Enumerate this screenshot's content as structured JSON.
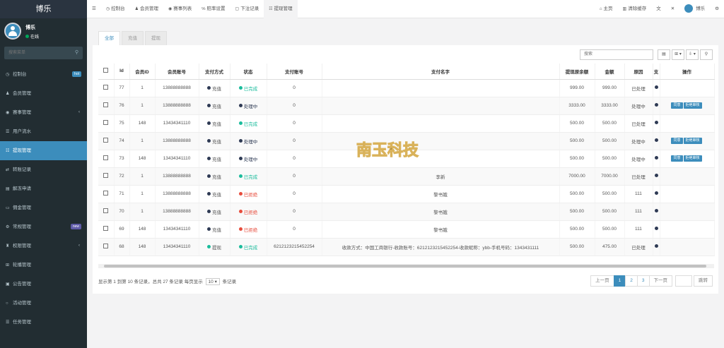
{
  "sidebar": {
    "brand": "博乐",
    "user_name": "博乐",
    "user_status": "在线",
    "search_placeholder": "搜索菜单",
    "items": [
      {
        "label": "控制台",
        "icon": "dashboard-icon",
        "glyph": "◷",
        "badge": "hot",
        "badge_color": "#3c8dbc"
      },
      {
        "label": "会员管理",
        "icon": "users-icon",
        "glyph": "♟"
      },
      {
        "label": "赛事管理",
        "icon": "event-icon",
        "glyph": "◉",
        "arrow": "‹"
      },
      {
        "label": "用户流水",
        "icon": "list-icon",
        "glyph": "☰"
      },
      {
        "label": "提现管理",
        "icon": "withdraw-icon",
        "glyph": "☷",
        "active": true
      },
      {
        "label": "转账记录",
        "icon": "transfer-icon",
        "glyph": "⇄"
      },
      {
        "label": "解冻申请",
        "icon": "unfreeze-icon",
        "glyph": "▤"
      },
      {
        "label": "佣金管理",
        "icon": "commission-icon",
        "glyph": "▭"
      },
      {
        "label": "常规管理",
        "icon": "settings-icon",
        "glyph": "⚙",
        "badge": "new",
        "badge_color": "#605ca8"
      },
      {
        "label": "权限管理",
        "icon": "permission-icon",
        "glyph": "♜",
        "arrow": "‹"
      },
      {
        "label": "轮播管理",
        "icon": "carousel-icon",
        "glyph": "⊞"
      },
      {
        "label": "公告管理",
        "icon": "notice-icon",
        "glyph": "▣"
      },
      {
        "label": "活动管理",
        "icon": "activity-icon",
        "glyph": "○"
      },
      {
        "label": "任务管理",
        "icon": "task-icon",
        "glyph": "☰"
      }
    ]
  },
  "topbar": {
    "menu_glyph": "☰",
    "tabs": [
      {
        "label": "控制台",
        "icon": "dashboard-icon",
        "glyph": "◷"
      },
      {
        "label": "会员管理",
        "icon": "users-icon",
        "glyph": "♟"
      },
      {
        "label": "赛事列表",
        "icon": "event-icon",
        "glyph": "◉"
      },
      {
        "label": "赔率设置",
        "icon": "odds-icon",
        "glyph": "℅"
      },
      {
        "label": "下注记录",
        "icon": "bet-icon",
        "glyph": "▢"
      },
      {
        "label": "提现管理",
        "icon": "withdraw-icon",
        "glyph": "☷",
        "active": true
      }
    ],
    "home_label": "主页",
    "clear_cache_label": "清除缓存",
    "translate_glyph": "文",
    "fullscreen_glyph": "✕",
    "user_label": "博乐",
    "settings_glyph": "⚙"
  },
  "panel": {
    "tabs": [
      "全部",
      "充值",
      "提现"
    ],
    "search_placeholder": "搜索",
    "toolbar_buttons": [
      "▤",
      "⊞ ▾",
      "⇩ ▾",
      "⚲"
    ],
    "columns": [
      "Id",
      "会员ID",
      "会员账号",
      "支付方式",
      "状态",
      "支付账号",
      "支付名字",
      "提现原余额",
      "金额",
      "原因",
      "支",
      "操作"
    ],
    "rows": [
      {
        "id": "77",
        "member_id": "1",
        "account": "13888888888",
        "pay_method": "充值",
        "pay_color": "#2e3a54",
        "status": "已完成",
        "status_color": "#1abc9c",
        "pay_account": "0",
        "pay_name": "",
        "orig_balance": "999.00",
        "amount": "999.00",
        "reason": "已处理",
        "actions": []
      },
      {
        "id": "76",
        "member_id": "1",
        "account": "13888888888",
        "pay_method": "充值",
        "pay_color": "#2e3a54",
        "status": "处理中",
        "status_color": "#2e3a54",
        "pay_account": "0",
        "pay_name": "",
        "orig_balance": "3333.00",
        "amount": "3333.00",
        "reason": "处理中",
        "actions": [
          "同意",
          "拒绝审核"
        ]
      },
      {
        "id": "75",
        "member_id": "148",
        "account": "13434341110",
        "pay_method": "充值",
        "pay_color": "#2e3a54",
        "status": "已完成",
        "status_color": "#1abc9c",
        "pay_account": "0",
        "pay_name": "",
        "orig_balance": "500.00",
        "amount": "500.00",
        "reason": "已处理",
        "actions": []
      },
      {
        "id": "74",
        "member_id": "1",
        "account": "13888888888",
        "pay_method": "充值",
        "pay_color": "#2e3a54",
        "status": "处理中",
        "status_color": "#2e3a54",
        "pay_account": "0",
        "pay_name": "",
        "orig_balance": "500.00",
        "amount": "500.00",
        "reason": "处理中",
        "actions": [
          "同意",
          "拒绝审核"
        ]
      },
      {
        "id": "73",
        "member_id": "148",
        "account": "13434341110",
        "pay_method": "充值",
        "pay_color": "#2e3a54",
        "status": "处理中",
        "status_color": "#2e3a54",
        "pay_account": "0",
        "pay_name": "",
        "orig_balance": "500.00",
        "amount": "500.00",
        "reason": "处理中",
        "actions": [
          "同意",
          "拒绝审核"
        ]
      },
      {
        "id": "72",
        "member_id": "1",
        "account": "13888888888",
        "pay_method": "充值",
        "pay_color": "#2e3a54",
        "status": "已完成",
        "status_color": "#1abc9c",
        "pay_account": "0",
        "pay_name": "李新",
        "orig_balance": "7000.00",
        "amount": "7000.00",
        "reason": "已处理",
        "actions": []
      },
      {
        "id": "71",
        "member_id": "1",
        "account": "13888888888",
        "pay_method": "充值",
        "pay_color": "#2e3a54",
        "status": "已拒绝",
        "status_color": "#e74c3c",
        "pay_account": "0",
        "pay_name": "黎书娥",
        "orig_balance": "500.00",
        "amount": "500.00",
        "reason": "111",
        "actions": []
      },
      {
        "id": "70",
        "member_id": "1",
        "account": "13888888888",
        "pay_method": "充值",
        "pay_color": "#2e3a54",
        "status": "已拒绝",
        "status_color": "#e74c3c",
        "pay_account": "0",
        "pay_name": "黎书娥",
        "orig_balance": "500.00",
        "amount": "500.00",
        "reason": "111",
        "actions": []
      },
      {
        "id": "69",
        "member_id": "148",
        "account": "13434341110",
        "pay_method": "充值",
        "pay_color": "#2e3a54",
        "status": "已拒绝",
        "status_color": "#e74c3c",
        "pay_account": "0",
        "pay_name": "黎书娥",
        "orig_balance": "500.00",
        "amount": "500.00",
        "reason": "111",
        "actions": []
      },
      {
        "id": "68",
        "member_id": "148",
        "account": "13434341110",
        "pay_method": "提现",
        "pay_color": "#1abc9c",
        "status": "已完成",
        "status_color": "#1abc9c",
        "pay_account": "6212123215452254",
        "pay_name": "收款方式：中国工商银行-收款账号：6212123215452254-收款昵称：ybb-手机号码：1343431111",
        "orig_balance": "500.00",
        "amount": "475.00",
        "reason": "已处理",
        "actions": []
      }
    ],
    "footer_info_prefix": "显示第 1 到第 10 条记录，总共 27 条记录 每页显示",
    "page_size": "10 ▾",
    "footer_info_suffix": "条记录",
    "pager": {
      "prev": "上一页",
      "pages": [
        "1",
        "2",
        "3"
      ],
      "next": "下一页",
      "jump": "跳转"
    },
    "watermark_text": "南玉科技"
  }
}
